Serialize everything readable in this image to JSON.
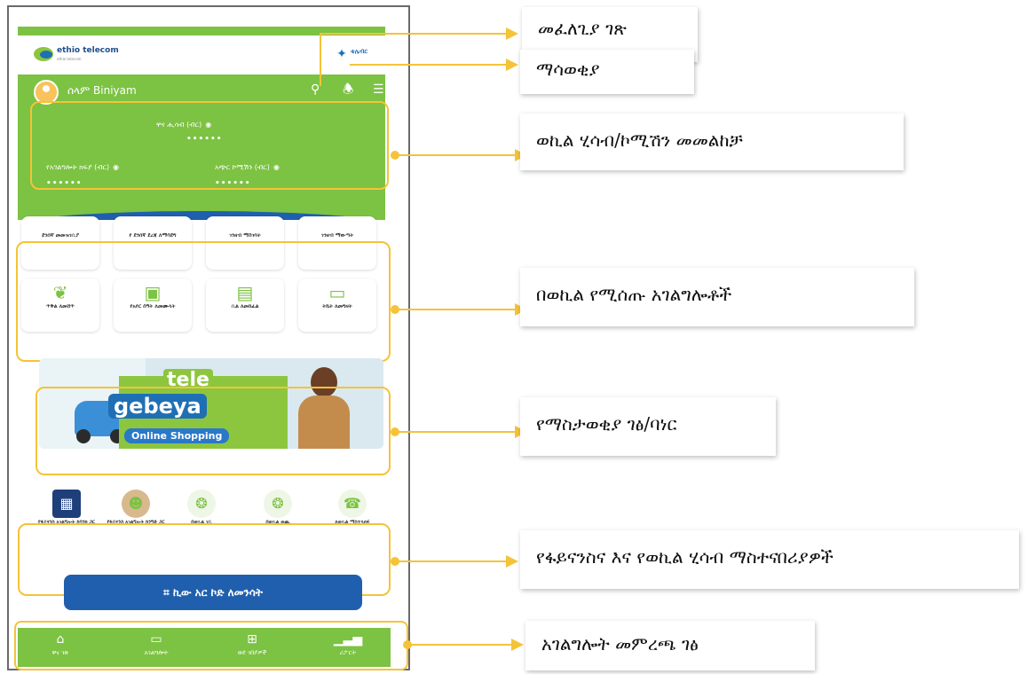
{
  "header": {
    "logo_text": "ethio telecom",
    "logo_subtext": "ethio telecom",
    "badge_text": "ቴሌብር"
  },
  "account": {
    "username": "ሰላም Biniyam",
    "main_balance_label": "ዋና ሒሳብ (ብር)",
    "main_balance_value": "••••••",
    "sub_balance_left_label": "የአገልግሎት ክፍያ (ብር)",
    "sub_balance_left_value": "••••••",
    "sub_balance_right_label": "አጭር ኮሚሽን (ብር)",
    "sub_balance_right_value": "••••••"
  },
  "services": [
    {
      "label": "ደንበኛ መመዝገቢያ"
    },
    {
      "label": "የ ደንበኛ ደረጃ ለማሳደግ"
    },
    {
      "label": "ገንዘብ ማስገባት"
    },
    {
      "label": "ገንዘብ ማውጣት"
    },
    {
      "label": "ጥቅል ለመሸጥ"
    },
    {
      "label": "የአየር ሰዓት ለመሙላት"
    },
    {
      "label": "ቢል ለመክፈል"
    },
    {
      "label": "ትኬት ለመግዛት"
    }
  ],
  "banner": {
    "title_top": "tele",
    "title_bottom": "gebeya",
    "tagline": "Online Shopping"
  },
  "financial_items": [
    {
      "label": "የፋይናንስ አገልግሎት ከባንክ ጋር"
    },
    {
      "label": "የፋይናንስ አገልግሎት ከንግድ ጋር"
    },
    {
      "label": "በወኪል ገቢ"
    },
    {
      "label": "በወኪል ወጪ"
    },
    {
      "label": "ለወኪል ማስተላለፍ"
    }
  ],
  "qr_button": "ኪው አር ኮድ ለመንሳት",
  "nav": [
    {
      "label": "ዋና ገጽ",
      "icon": "home-icon"
    },
    {
      "label": "አገልግሎት",
      "icon": "services-icon"
    },
    {
      "label": "ወደ ገበያዎች",
      "icon": "grid-icon"
    },
    {
      "label": "ሪፖርት",
      "icon": "chart-icon"
    }
  ],
  "callouts": {
    "search": "መፈለጊያ ገጽ",
    "notification": "ማሳወቂያ",
    "balance": "ወኪል ሂሳብ/ኮሚሽን መመልከቻ",
    "services": "በወኪል የሚሰጡ አገልግሎቶች",
    "banner": "የማስታወቂያ ገፅ/ባነር",
    "financial": "የፋይናንስና እና የወኪል ሂሳብ ማስተናበሪያዎች",
    "nav": "አገልግሎት መምረጫ ገፅ"
  },
  "colors": {
    "brand_green": "#7cc243",
    "brand_blue": "#1f5fae",
    "highlight": "#f5c338"
  }
}
